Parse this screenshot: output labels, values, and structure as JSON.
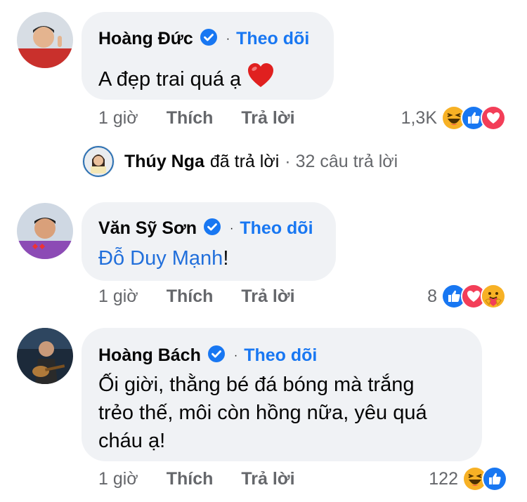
{
  "comments": [
    {
      "author": "Hoàng Đức",
      "follow": "Theo dõi",
      "dot": "·",
      "text": "A đẹp trai quá ạ",
      "emoji": "red-heart",
      "time": "1 giờ",
      "like": "Thích",
      "reply": "Trả lời",
      "reaction_count": "1,3K",
      "reactions": [
        "haha",
        "like",
        "love"
      ]
    },
    {
      "author": "Văn Sỹ Sơn",
      "follow": "Theo dõi",
      "dot": "·",
      "mention": "Đỗ Duy Mạnh",
      "text_suffix": "!",
      "time": "1 giờ",
      "like": "Thích",
      "reply": "Trả lời",
      "reaction_count": "8",
      "reactions": [
        "like",
        "love",
        "care"
      ]
    },
    {
      "author": "Hoàng Bách",
      "follow": "Theo dõi",
      "dot": "·",
      "text_lines": [
        "Ối giời, thằng bé đá bóng mà trắng",
        "trẻo thế, môi còn hồng nữa, yêu quá",
        "cháu ạ!"
      ],
      "time": "1 giờ",
      "like": "Thích",
      "reply": "Trả lời",
      "reaction_count": "122",
      "reactions": [
        "haha",
        "like"
      ]
    }
  ],
  "reply_summary": {
    "name": "Thúy Nga",
    "verb": "đã trả lời",
    "count": "· 32 câu trả lời"
  },
  "colors": {
    "bubble": "#f0f2f5",
    "link": "#1877f2",
    "meta": "#65676b",
    "like_blue": "#1877f2",
    "love_red": "#f33e58",
    "haha_yellow": "#f7b125"
  }
}
